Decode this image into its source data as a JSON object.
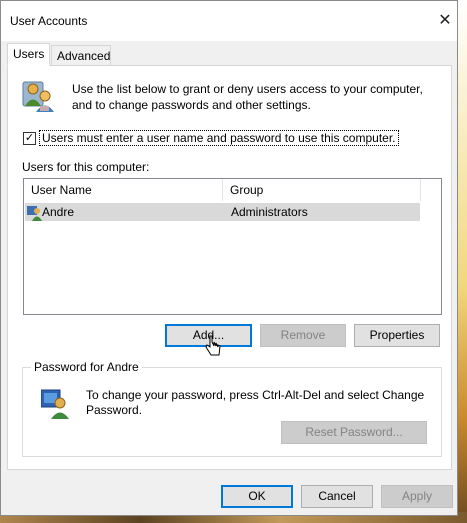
{
  "window": {
    "title": "User Accounts"
  },
  "tabs": [
    {
      "label": "Users",
      "active": true
    },
    {
      "label": "Advanced",
      "active": false
    }
  ],
  "intro": {
    "text": "Use the list below to grant or deny users access to your computer, and to change passwords and other settings."
  },
  "require_login": {
    "label": "Users must enter a user name and password to use this computer.",
    "checked": true
  },
  "users_section": {
    "label": "Users for this computer:",
    "columns": [
      "User Name",
      "Group"
    ],
    "rows": [
      {
        "user_name": "Andre",
        "group": "Administrators",
        "selected": true
      }
    ]
  },
  "buttons": {
    "add": "Add...",
    "remove": "Remove",
    "properties": "Properties"
  },
  "password_group": {
    "title": "Password for Andre",
    "text": "To change your password, press Ctrl-Alt-Del and select Change Password.",
    "reset_button": "Reset Password..."
  },
  "footer": {
    "ok": "OK",
    "cancel": "Cancel",
    "apply": "Apply"
  },
  "colors": {
    "accent": "#0078d7",
    "selected_row": "#d9d9d9",
    "disabled_text": "#838383"
  }
}
